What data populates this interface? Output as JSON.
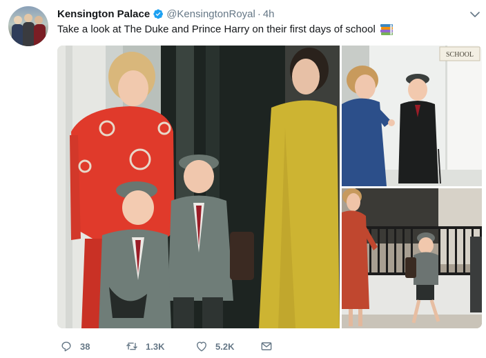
{
  "tweet": {
    "display_name": "Kensington Palace",
    "handle": "@KensingtonRoyal",
    "separator": "·",
    "timestamp": "4h",
    "text": "Take a look at The Duke and Prince Harry on their first days of school",
    "emoji": "books-emoji",
    "verified": true
  },
  "media": {
    "school_sign": "SCHOOL"
  },
  "actions": {
    "replies": "38",
    "retweets": "1.3K",
    "likes": "5.2K"
  },
  "colors": {
    "text": "#14171a",
    "secondary": "#657786",
    "verified_blue": "#1da1f2"
  }
}
